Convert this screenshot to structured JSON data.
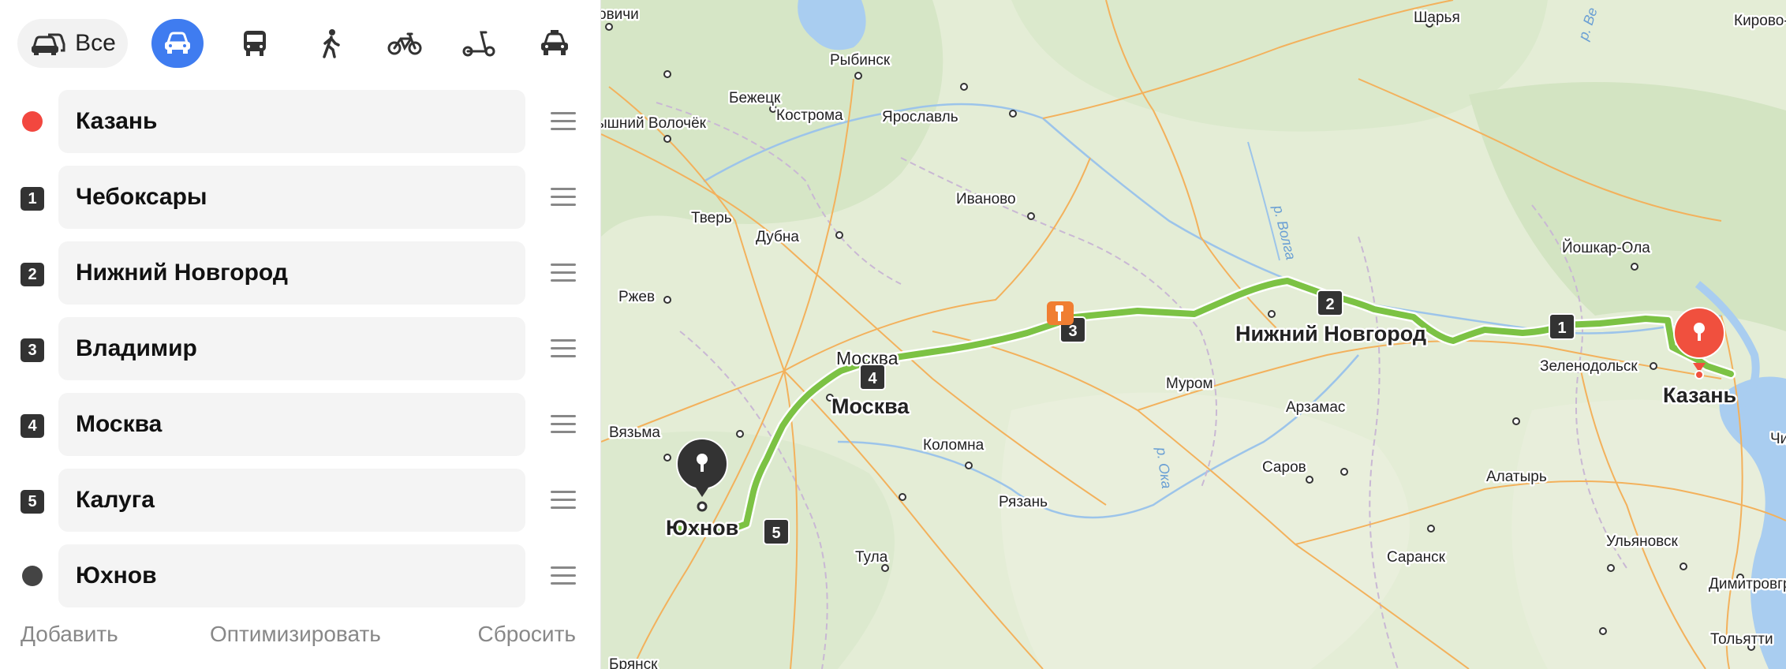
{
  "modes": {
    "all_label": "Все",
    "items": [
      {
        "name": "all",
        "icon": "cars-icon"
      },
      {
        "name": "car",
        "icon": "car-icon",
        "active": true
      },
      {
        "name": "bus",
        "icon": "bus-icon"
      },
      {
        "name": "walk",
        "icon": "pedestrian-icon"
      },
      {
        "name": "bike",
        "icon": "bicycle-icon"
      },
      {
        "name": "scooter",
        "icon": "scooter-icon"
      },
      {
        "name": "taxi",
        "icon": "taxi-icon"
      }
    ],
    "active_color": "#3f7cf0"
  },
  "route": {
    "stops": [
      {
        "marker": "",
        "value": "Казань",
        "type": "start"
      },
      {
        "marker": "1",
        "value": "Чебоксары",
        "type": "waypoint"
      },
      {
        "marker": "2",
        "value": "Нижний Новгород",
        "type": "waypoint"
      },
      {
        "marker": "3",
        "value": "Владимир",
        "type": "waypoint"
      },
      {
        "marker": "4",
        "value": "Москва",
        "type": "waypoint"
      },
      {
        "marker": "5",
        "value": "Калуга",
        "type": "waypoint"
      },
      {
        "marker": "",
        "value": "Юхнов",
        "type": "end"
      }
    ],
    "start_color": "#f2473f",
    "end_color": "#444444",
    "route_color": "#7cc244"
  },
  "actions": {
    "add": "Добавить",
    "optimize": "Оптимизировать",
    "reset": "Сбросить"
  },
  "map": {
    "major_cities": {
      "moscow": "Москва",
      "nizhny": "Нижний Новгород",
      "kazan": "Казань",
      "yukhnov": "Юхнов"
    },
    "cities": [
      "Рыбинск",
      "Бежецк",
      "Ярославль",
      "Кострома",
      "Шарья",
      "Кирово-Ч",
      "ышний Волочёк",
      "овичи",
      "Тверь",
      "Дубна",
      "Иваново",
      "Ржев",
      "Москва",
      "Йошкар-Ола",
      "Зеленодольск",
      "Муром",
      "Арзамас",
      "Вязьма",
      "Коломна",
      "Рязань",
      "Саров",
      "Алатырь",
      "Ульяновск",
      "Саранск",
      "Тула",
      "Димитровгра",
      "Тольятти",
      "Брянск",
      "Чи"
    ],
    "rivers": [
      "р. Волга",
      "р. Ока",
      "р. Ве"
    ],
    "route_markers": [
      "1",
      "2",
      "3",
      "4",
      "5"
    ]
  }
}
